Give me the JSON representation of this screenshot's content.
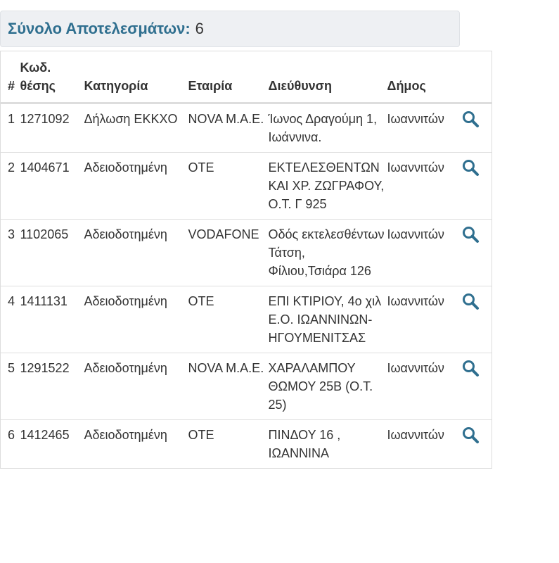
{
  "summary": {
    "label": "Σύνολο Αποτελεσμάτων:",
    "count": "6"
  },
  "table": {
    "headers": {
      "num": "#",
      "code": "Κωδ. θέσης",
      "category": "Κατηγορία",
      "company": "Εταιρία",
      "address": "Διεύθυνση",
      "municipality": "Δήμος"
    },
    "rows": [
      {
        "num": "1",
        "code": "1271092",
        "category": "Δήλωση ΕΚΚΧΟ",
        "company": "NOVA Μ.Α.Ε.",
        "address": "Ίωνος Δραγούμη 1, Ιωάννινα.",
        "municipality": "Ιωαννιτών",
        "action_icon": "search-icon"
      },
      {
        "num": "2",
        "code": "1404671",
        "category": "Αδειοδοτημένη",
        "company": "ΟΤΕ",
        "address": "ΕΚΤΕΛΕΣΘΕΝΤΩΝ ΚΑΙ ΧΡ. ΖΩΓΡΑΦΟΥ, Ο.Τ. Γ 925",
        "municipality": "Ιωαννιτών",
        "action_icon": "search-icon"
      },
      {
        "num": "3",
        "code": "1102065",
        "category": "Αδειοδοτημένη",
        "company": "VODAFONE",
        "address": "Οδός εκτελεσθέντων Τάτση, Φίλιου,Τσιάρα 126",
        "municipality": "Ιωαννιτών",
        "action_icon": "search-icon"
      },
      {
        "num": "4",
        "code": "1411131",
        "category": "Αδειοδοτημένη",
        "company": "ΟΤΕ",
        "address": "ΕΠΙ ΚΤΙΡΙΟΥ, 4ο χιλ Ε.Ο. ΙΩΑΝΝΙΝΩΝ-ΗΓΟΥΜΕΝΙΤΣΑΣ",
        "municipality": "Ιωαννιτών",
        "action_icon": "search-icon"
      },
      {
        "num": "5",
        "code": "1291522",
        "category": "Αδειοδοτημένη",
        "company": "NOVA Μ.Α.Ε.",
        "address": "ΧΑΡΑΛΑΜΠΟΥ ΘΩΜΟΥ 25Β (Ο.Τ. 25)",
        "municipality": "Ιωαννιτών",
        "action_icon": "search-icon"
      },
      {
        "num": "6",
        "code": "1412465",
        "category": "Αδειοδοτημένη",
        "company": "ΟΤΕ",
        "address": "ΠΙΝΔΟΥ 16 , ΙΩΑΝΝΙΝΑ",
        "municipality": "Ιωαννιτών",
        "action_icon": "search-icon"
      }
    ]
  },
  "colors": {
    "accent": "#2f6f8f",
    "icon": "#2f6f8f",
    "summary_bg": "#eef0f3",
    "border": "#dddddd"
  }
}
